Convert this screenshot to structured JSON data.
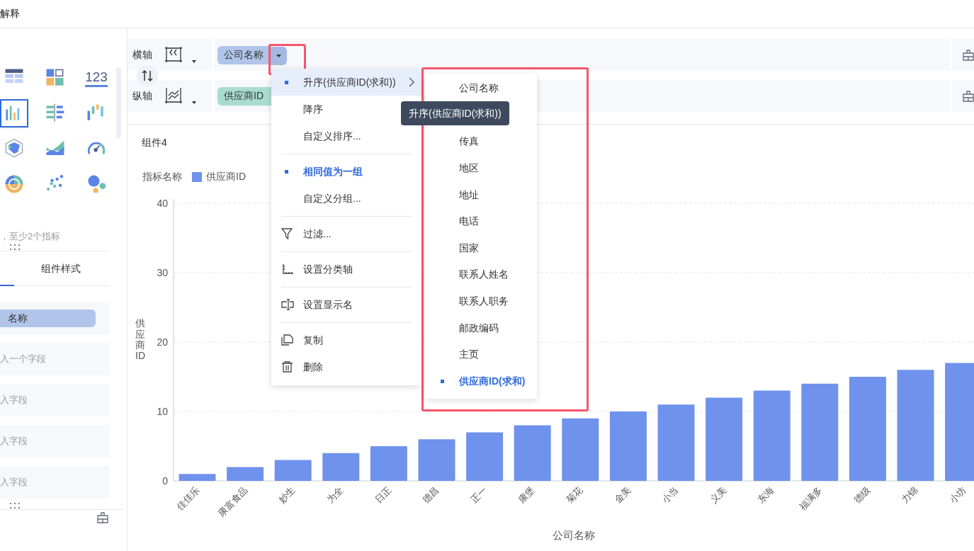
{
  "header": {
    "title": "解释"
  },
  "chart_types": [
    {
      "kind": "table",
      "selected": false
    },
    {
      "kind": "card",
      "selected": false
    },
    {
      "kind": "number",
      "label": "123",
      "selected": false
    },
    {
      "kind": "bar",
      "selected": true
    },
    {
      "kind": "barh",
      "selected": false
    },
    {
      "kind": "waterfall",
      "selected": false
    },
    {
      "kind": "radar",
      "selected": false
    },
    {
      "kind": "area",
      "selected": false
    },
    {
      "kind": "gauge",
      "selected": false
    },
    {
      "kind": "pie",
      "selected": false
    },
    {
      "kind": "scatter",
      "selected": false
    },
    {
      "kind": "bubble",
      "selected": false
    }
  ],
  "hint": "，至少2个指标",
  "style_tab": {
    "label": "组件样式",
    "selected": false
  },
  "fields": [
    {
      "kind": "chip",
      "text": "名称"
    },
    {
      "kind": "placeholder",
      "text": "入一个字段"
    },
    {
      "kind": "placeholder",
      "text": "入字段"
    },
    {
      "kind": "placeholder",
      "text": "入字段"
    },
    {
      "kind": "placeholder",
      "text": "入字段"
    }
  ],
  "axes": [
    {
      "label": "横轴",
      "kind": "x",
      "field": "公司名称",
      "color": "#b1c5ea",
      "dropdown": true,
      "highlighted": true
    },
    {
      "label": "纵轴",
      "kind": "y",
      "field": "供应商ID",
      "color": "#a9dccf",
      "dropdown": false,
      "highlighted": false
    }
  ],
  "component": {
    "title": "组件4",
    "legend_title": "指标名称",
    "chart_data": {
      "type": "bar",
      "xlabel": "公司名称",
      "ylabel": "供应商ID",
      "categories": [
        "佳佳乐",
        "康富食品",
        "妙生",
        "为全",
        "日正",
        "德昌",
        "正一",
        "康堡",
        "菊花",
        "金美",
        "小当",
        "义美",
        "东海",
        "福满多",
        "德级",
        "力锦",
        "小坊"
      ],
      "series": [
        {
          "name": "供应商ID",
          "color": "#6f93ec",
          "values": [
            1,
            2,
            3,
            4,
            5,
            6,
            7,
            8,
            9,
            10,
            11,
            12,
            13,
            14,
            15,
            16,
            17
          ]
        }
      ],
      "grid": true,
      "ylim": [
        0,
        40
      ],
      "yticks": [
        0,
        10,
        20,
        30,
        40
      ]
    }
  },
  "menu": {
    "groups": [
      [
        {
          "label": "升序(供应商ID(求和))",
          "checked": true,
          "selected": true,
          "submenu": true
        },
        {
          "label": "降序",
          "checked": false,
          "selected": false
        },
        {
          "label": "自定义排序...",
          "checked": false,
          "selected": false
        }
      ],
      [
        {
          "label": "相同值为一组",
          "checked": true,
          "selected": false
        },
        {
          "label": "自定义分组...",
          "checked": false,
          "selected": false
        }
      ],
      [
        {
          "label": "过滤...",
          "kind": "filter",
          "checked": false,
          "selected": false
        }
      ],
      [
        {
          "label": "设置分类轴",
          "kind": "axis",
          "checked": false,
          "selected": false
        }
      ],
      [
        {
          "label": "设置显示名",
          "kind": "rename",
          "checked": false,
          "selected": false
        }
      ],
      [
        {
          "label": "复制",
          "kind": "copy",
          "checked": false,
          "selected": false
        },
        {
          "label": "删除",
          "kind": "delete",
          "checked": false,
          "selected": false
        }
      ]
    ]
  },
  "submenu": {
    "highlighted": true,
    "items": [
      {
        "label": "公司名称",
        "checked": false
      },
      {
        "label": "传真",
        "checked": false
      },
      {
        "label": "地区",
        "checked": false
      },
      {
        "label": "地址",
        "checked": false
      },
      {
        "label": "电话",
        "checked": false
      },
      {
        "label": "国家",
        "checked": false
      },
      {
        "label": "联系人姓名",
        "checked": false
      },
      {
        "label": "联系人职务",
        "checked": false
      },
      {
        "label": "邮政编码",
        "checked": false
      },
      {
        "label": "主页",
        "checked": false
      },
      {
        "label": "供应商ID(求和)",
        "checked": true
      }
    ]
  },
  "tooltip": "升序(供应商ID(求和))"
}
